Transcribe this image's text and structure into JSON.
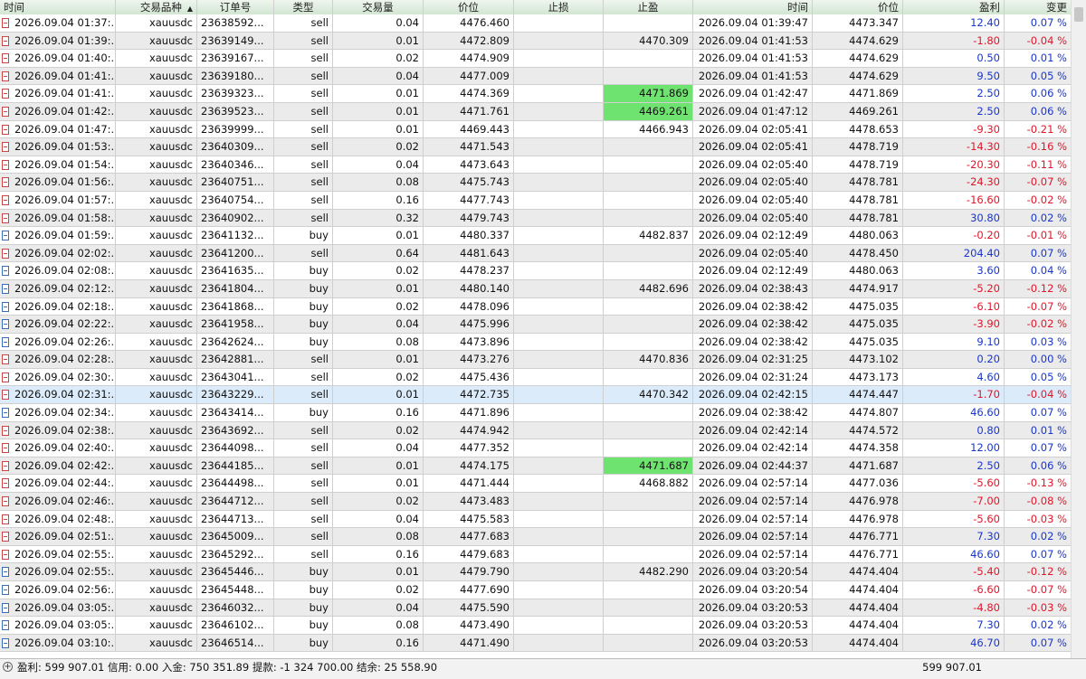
{
  "columns": [
    "时间",
    "交易品种",
    "订单号",
    "类型",
    "交易量",
    "价位",
    "止损",
    "止盈",
    "时间",
    "价位",
    "盈利",
    "变更"
  ],
  "sorted_column_index": 1,
  "rows": [
    {
      "open_time": "2026.09.04 01:37:...",
      "symbol": "xauusdc",
      "ticket": "23638592...",
      "type": "sell",
      "volume": "0.04",
      "price": "4476.460",
      "sl": "",
      "tp": "",
      "close_time": "2026.09.04 01:39:47",
      "close_price": "4473.347",
      "profit": "12.40",
      "change": "0.07 %"
    },
    {
      "open_time": "2026.09.04 01:39:...",
      "symbol": "xauusdc",
      "ticket": "23639149...",
      "type": "sell",
      "volume": "0.01",
      "price": "4472.809",
      "sl": "",
      "tp": "4470.309",
      "close_time": "2026.09.04 01:41:53",
      "close_price": "4474.629",
      "profit": "-1.80",
      "change": "-0.04 %"
    },
    {
      "open_time": "2026.09.04 01:40:...",
      "symbol": "xauusdc",
      "ticket": "23639167...",
      "type": "sell",
      "volume": "0.02",
      "price": "4474.909",
      "sl": "",
      "tp": "",
      "close_time": "2026.09.04 01:41:53",
      "close_price": "4474.629",
      "profit": "0.50",
      "change": "0.01 %"
    },
    {
      "open_time": "2026.09.04 01:41:...",
      "symbol": "xauusdc",
      "ticket": "23639180...",
      "type": "sell",
      "volume": "0.04",
      "price": "4477.009",
      "sl": "",
      "tp": "",
      "close_time": "2026.09.04 01:41:53",
      "close_price": "4474.629",
      "profit": "9.50",
      "change": "0.05 %"
    },
    {
      "open_time": "2026.09.04 01:41:...",
      "symbol": "xauusdc",
      "ticket": "23639323...",
      "type": "sell",
      "volume": "0.01",
      "price": "4474.369",
      "sl": "",
      "tp": "4471.869",
      "tp_hit": true,
      "close_time": "2026.09.04 01:42:47",
      "close_price": "4471.869",
      "profit": "2.50",
      "change": "0.06 %"
    },
    {
      "open_time": "2026.09.04 01:42:...",
      "symbol": "xauusdc",
      "ticket": "23639523...",
      "type": "sell",
      "volume": "0.01",
      "price": "4471.761",
      "sl": "",
      "tp": "4469.261",
      "tp_hit": true,
      "close_time": "2026.09.04 01:47:12",
      "close_price": "4469.261",
      "profit": "2.50",
      "change": "0.06 %"
    },
    {
      "open_time": "2026.09.04 01:47:...",
      "symbol": "xauusdc",
      "ticket": "23639999...",
      "type": "sell",
      "volume": "0.01",
      "price": "4469.443",
      "sl": "",
      "tp": "4466.943",
      "close_time": "2026.09.04 02:05:41",
      "close_price": "4478.653",
      "profit": "-9.30",
      "change": "-0.21 %"
    },
    {
      "open_time": "2026.09.04 01:53:...",
      "symbol": "xauusdc",
      "ticket": "23640309...",
      "type": "sell",
      "volume": "0.02",
      "price": "4471.543",
      "sl": "",
      "tp": "",
      "close_time": "2026.09.04 02:05:41",
      "close_price": "4478.719",
      "profit": "-14.30",
      "change": "-0.16 %"
    },
    {
      "open_time": "2026.09.04 01:54:...",
      "symbol": "xauusdc",
      "ticket": "23640346...",
      "type": "sell",
      "volume": "0.04",
      "price": "4473.643",
      "sl": "",
      "tp": "",
      "close_time": "2026.09.04 02:05:40",
      "close_price": "4478.719",
      "profit": "-20.30",
      "change": "-0.11 %"
    },
    {
      "open_time": "2026.09.04 01:56:...",
      "symbol": "xauusdc",
      "ticket": "23640751...",
      "type": "sell",
      "volume": "0.08",
      "price": "4475.743",
      "sl": "",
      "tp": "",
      "close_time": "2026.09.04 02:05:40",
      "close_price": "4478.781",
      "profit": "-24.30",
      "change": "-0.07 %"
    },
    {
      "open_time": "2026.09.04 01:57:...",
      "symbol": "xauusdc",
      "ticket": "23640754...",
      "type": "sell",
      "volume": "0.16",
      "price": "4477.743",
      "sl": "",
      "tp": "",
      "close_time": "2026.09.04 02:05:40",
      "close_price": "4478.781",
      "profit": "-16.60",
      "change": "-0.02 %"
    },
    {
      "open_time": "2026.09.04 01:58:...",
      "symbol": "xauusdc",
      "ticket": "23640902...",
      "type": "sell",
      "volume": "0.32",
      "price": "4479.743",
      "sl": "",
      "tp": "",
      "close_time": "2026.09.04 02:05:40",
      "close_price": "4478.781",
      "profit": "30.80",
      "change": "0.02 %"
    },
    {
      "open_time": "2026.09.04 01:59:...",
      "symbol": "xauusdc",
      "ticket": "23641132...",
      "type": "buy",
      "volume": "0.01",
      "price": "4480.337",
      "sl": "",
      "tp": "4482.837",
      "close_time": "2026.09.04 02:12:49",
      "close_price": "4480.063",
      "profit": "-0.20",
      "change": "-0.01 %"
    },
    {
      "open_time": "2026.09.04 02:02:...",
      "symbol": "xauusdc",
      "ticket": "23641200...",
      "type": "sell",
      "volume": "0.64",
      "price": "4481.643",
      "sl": "",
      "tp": "",
      "close_time": "2026.09.04 02:05:40",
      "close_price": "4478.450",
      "profit": "204.40",
      "change": "0.07 %"
    },
    {
      "open_time": "2026.09.04 02:08:...",
      "symbol": "xauusdc",
      "ticket": "23641635...",
      "type": "buy",
      "volume": "0.02",
      "price": "4478.237",
      "sl": "",
      "tp": "",
      "close_time": "2026.09.04 02:12:49",
      "close_price": "4480.063",
      "profit": "3.60",
      "change": "0.04 %"
    },
    {
      "open_time": "2026.09.04 02:12:...",
      "symbol": "xauusdc",
      "ticket": "23641804...",
      "type": "buy",
      "volume": "0.01",
      "price": "4480.140",
      "sl": "",
      "tp": "4482.696",
      "close_time": "2026.09.04 02:38:43",
      "close_price": "4474.917",
      "profit": "-5.20",
      "change": "-0.12 %"
    },
    {
      "open_time": "2026.09.04 02:18:...",
      "symbol": "xauusdc",
      "ticket": "23641868...",
      "type": "buy",
      "volume": "0.02",
      "price": "4478.096",
      "sl": "",
      "tp": "",
      "close_time": "2026.09.04 02:38:42",
      "close_price": "4475.035",
      "profit": "-6.10",
      "change": "-0.07 %"
    },
    {
      "open_time": "2026.09.04 02:22:...",
      "symbol": "xauusdc",
      "ticket": "23641958...",
      "type": "buy",
      "volume": "0.04",
      "price": "4475.996",
      "sl": "",
      "tp": "",
      "close_time": "2026.09.04 02:38:42",
      "close_price": "4475.035",
      "profit": "-3.90",
      "change": "-0.02 %"
    },
    {
      "open_time": "2026.09.04 02:26:...",
      "symbol": "xauusdc",
      "ticket": "23642624...",
      "type": "buy",
      "volume": "0.08",
      "price": "4473.896",
      "sl": "",
      "tp": "",
      "close_time": "2026.09.04 02:38:42",
      "close_price": "4475.035",
      "profit": "9.10",
      "change": "0.03 %"
    },
    {
      "open_time": "2026.09.04 02:28:...",
      "symbol": "xauusdc",
      "ticket": "23642881...",
      "type": "sell",
      "volume": "0.01",
      "price": "4473.276",
      "sl": "",
      "tp": "4470.836",
      "close_time": "2026.09.04 02:31:25",
      "close_price": "4473.102",
      "profit": "0.20",
      "change": "0.00 %"
    },
    {
      "open_time": "2026.09.04 02:30:...",
      "symbol": "xauusdc",
      "ticket": "23643041...",
      "type": "sell",
      "volume": "0.02",
      "price": "4475.436",
      "sl": "",
      "tp": "",
      "close_time": "2026.09.04 02:31:24",
      "close_price": "4473.173",
      "profit": "4.60",
      "change": "0.05 %"
    },
    {
      "open_time": "2026.09.04 02:31:...",
      "symbol": "xauusdc",
      "ticket": "23643229...",
      "type": "sell",
      "volume": "0.01",
      "price": "4472.735",
      "sl": "",
      "tp": "4470.342",
      "selected": true,
      "close_time": "2026.09.04 02:42:15",
      "close_price": "4474.447",
      "profit": "-1.70",
      "change": "-0.04 %"
    },
    {
      "open_time": "2026.09.04 02:34:...",
      "symbol": "xauusdc",
      "ticket": "23643414...",
      "type": "buy",
      "volume": "0.16",
      "price": "4471.896",
      "sl": "",
      "tp": "",
      "close_time": "2026.09.04 02:38:42",
      "close_price": "4474.807",
      "profit": "46.60",
      "change": "0.07 %"
    },
    {
      "open_time": "2026.09.04 02:38:...",
      "symbol": "xauusdc",
      "ticket": "23643692...",
      "type": "sell",
      "volume": "0.02",
      "price": "4474.942",
      "sl": "",
      "tp": "",
      "close_time": "2026.09.04 02:42:14",
      "close_price": "4474.572",
      "profit": "0.80",
      "change": "0.01 %"
    },
    {
      "open_time": "2026.09.04 02:40:...",
      "symbol": "xauusdc",
      "ticket": "23644098...",
      "type": "sell",
      "volume": "0.04",
      "price": "4477.352",
      "sl": "",
      "tp": "",
      "close_time": "2026.09.04 02:42:14",
      "close_price": "4474.358",
      "profit": "12.00",
      "change": "0.07 %"
    },
    {
      "open_time": "2026.09.04 02:42:...",
      "symbol": "xauusdc",
      "ticket": "23644185...",
      "type": "sell",
      "volume": "0.01",
      "price": "4474.175",
      "sl": "",
      "tp": "4471.687",
      "tp_hit": true,
      "close_time": "2026.09.04 02:44:37",
      "close_price": "4471.687",
      "profit": "2.50",
      "change": "0.06 %"
    },
    {
      "open_time": "2026.09.04 02:44:...",
      "symbol": "xauusdc",
      "ticket": "23644498...",
      "type": "sell",
      "volume": "0.01",
      "price": "4471.444",
      "sl": "",
      "tp": "4468.882",
      "close_time": "2026.09.04 02:57:14",
      "close_price": "4477.036",
      "profit": "-5.60",
      "change": "-0.13 %"
    },
    {
      "open_time": "2026.09.04 02:46:...",
      "symbol": "xauusdc",
      "ticket": "23644712...",
      "type": "sell",
      "volume": "0.02",
      "price": "4473.483",
      "sl": "",
      "tp": "",
      "close_time": "2026.09.04 02:57:14",
      "close_price": "4476.978",
      "profit": "-7.00",
      "change": "-0.08 %"
    },
    {
      "open_time": "2026.09.04 02:48:...",
      "symbol": "xauusdc",
      "ticket": "23644713...",
      "type": "sell",
      "volume": "0.04",
      "price": "4475.583",
      "sl": "",
      "tp": "",
      "close_time": "2026.09.04 02:57:14",
      "close_price": "4476.978",
      "profit": "-5.60",
      "change": "-0.03 %"
    },
    {
      "open_time": "2026.09.04 02:51:...",
      "symbol": "xauusdc",
      "ticket": "23645009...",
      "type": "sell",
      "volume": "0.08",
      "price": "4477.683",
      "sl": "",
      "tp": "",
      "close_time": "2026.09.04 02:57:14",
      "close_price": "4476.771",
      "profit": "7.30",
      "change": "0.02 %"
    },
    {
      "open_time": "2026.09.04 02:55:...",
      "symbol": "xauusdc",
      "ticket": "23645292...",
      "type": "sell",
      "volume": "0.16",
      "price": "4479.683",
      "sl": "",
      "tp": "",
      "close_time": "2026.09.04 02:57:14",
      "close_price": "4476.771",
      "profit": "46.60",
      "change": "0.07 %"
    },
    {
      "open_time": "2026.09.04 02:55:...",
      "symbol": "xauusdc",
      "ticket": "23645446...",
      "type": "buy",
      "volume": "0.01",
      "price": "4479.790",
      "sl": "",
      "tp": "4482.290",
      "close_time": "2026.09.04 03:20:54",
      "close_price": "4474.404",
      "profit": "-5.40",
      "change": "-0.12 %"
    },
    {
      "open_time": "2026.09.04 02:56:...",
      "symbol": "xauusdc",
      "ticket": "23645448...",
      "type": "buy",
      "volume": "0.02",
      "price": "4477.690",
      "sl": "",
      "tp": "",
      "close_time": "2026.09.04 03:20:54",
      "close_price": "4474.404",
      "profit": "-6.60",
      "change": "-0.07 %"
    },
    {
      "open_time": "2026.09.04 03:05:...",
      "symbol": "xauusdc",
      "ticket": "23646032...",
      "type": "buy",
      "volume": "0.04",
      "price": "4475.590",
      "sl": "",
      "tp": "",
      "close_time": "2026.09.04 03:20:53",
      "close_price": "4474.404",
      "profit": "-4.80",
      "change": "-0.03 %"
    },
    {
      "open_time": "2026.09.04 03:05:...",
      "symbol": "xauusdc",
      "ticket": "23646102...",
      "type": "buy",
      "volume": "0.08",
      "price": "4473.490",
      "sl": "",
      "tp": "",
      "close_time": "2026.09.04 03:20:53",
      "close_price": "4474.404",
      "profit": "7.30",
      "change": "0.02 %"
    },
    {
      "open_time": "2026.09.04 03:10:...",
      "symbol": "xauusdc",
      "ticket": "23646514...",
      "type": "buy",
      "volume": "0.16",
      "price": "4471.490",
      "sl": "",
      "tp": "",
      "close_time": "2026.09.04 03:20:53",
      "close_price": "4474.404",
      "profit": "46.70",
      "change": "0.07 %"
    }
  ],
  "footer": {
    "summary": "盈利: 599 907.01  信用: 0.00  入金: 750 351.89  提款: -1 324 700.00  结余: 25 558.90",
    "total_profit": "599 907.01"
  },
  "colors": {
    "profit_positive": "#1a36c8",
    "profit_negative": "#e0162b",
    "tp_hit": "#6fe36f",
    "selected_row": "#dcebf9"
  }
}
